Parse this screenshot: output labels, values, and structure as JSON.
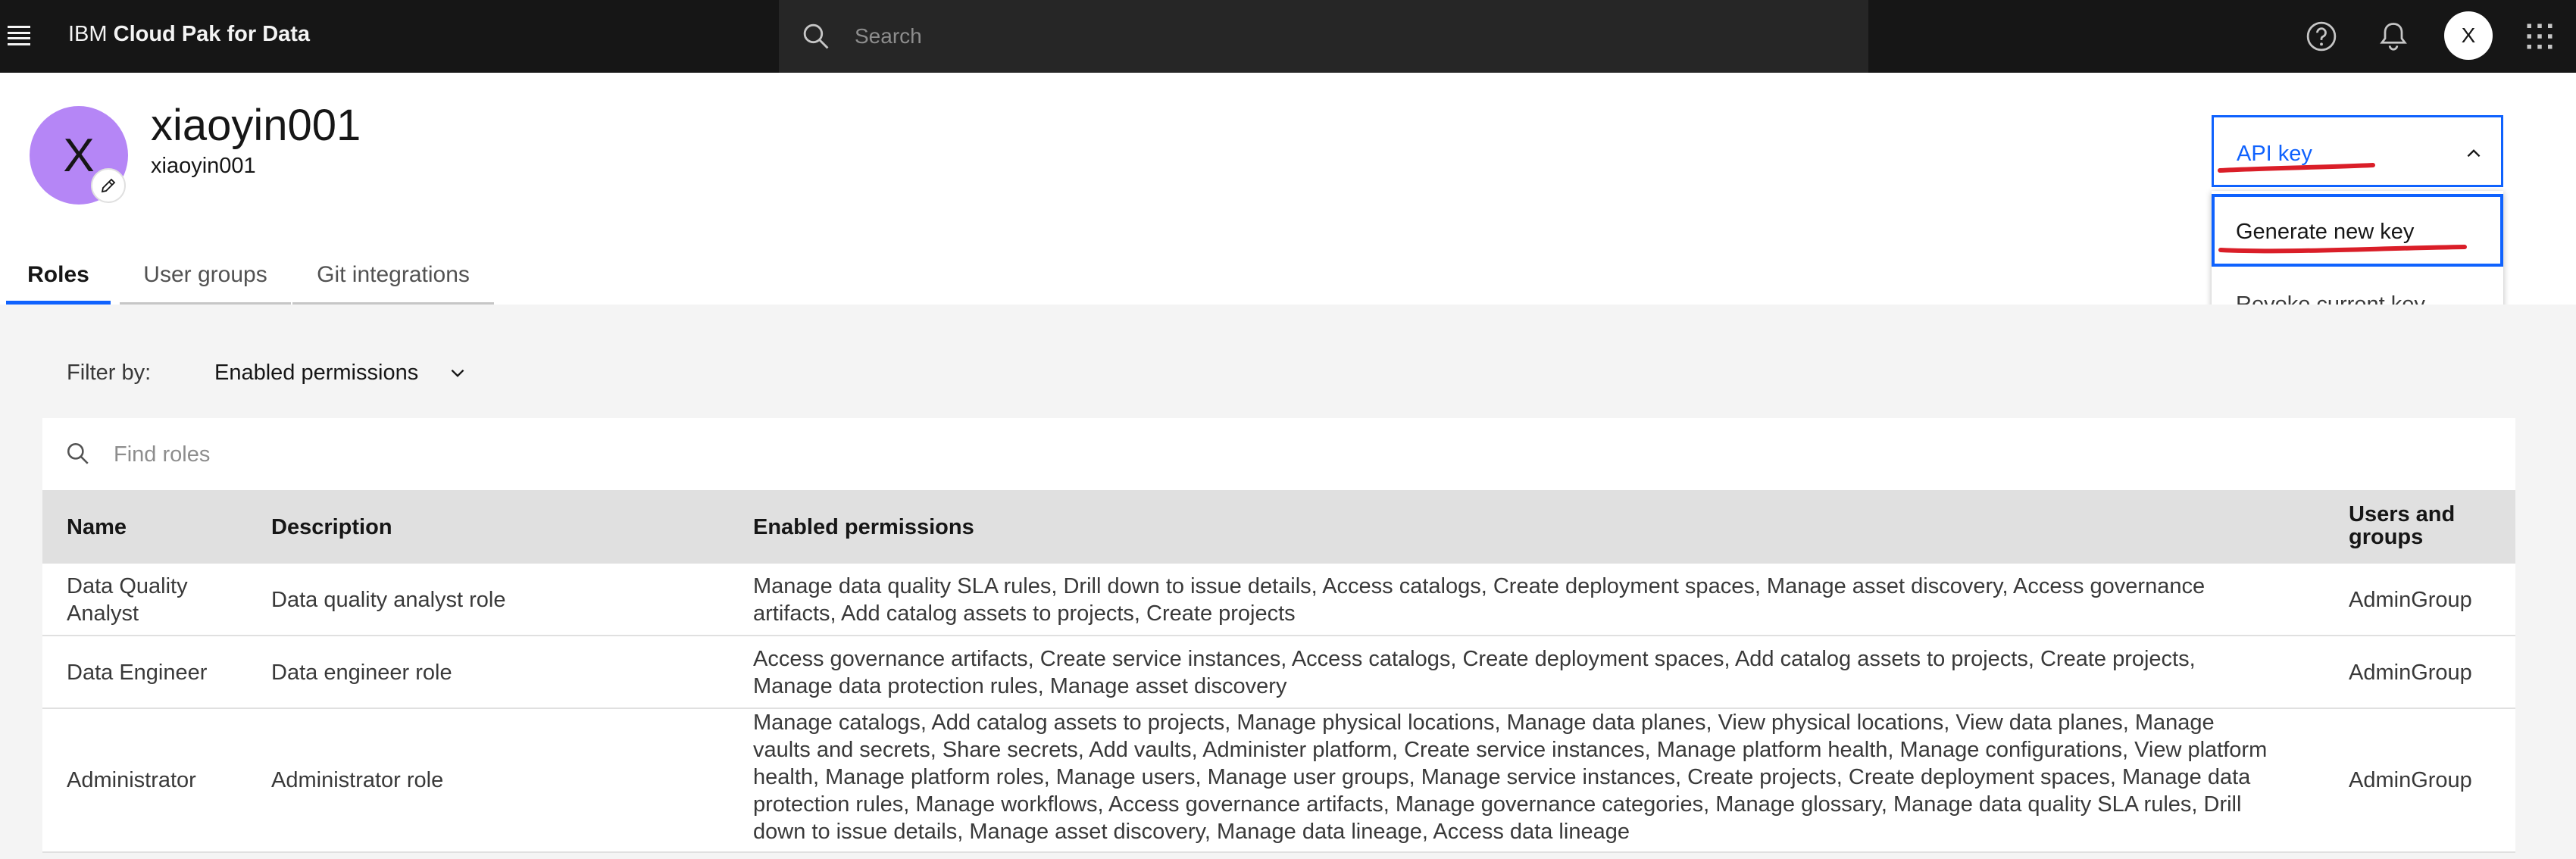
{
  "app": {
    "brand_prefix": "IBM",
    "brand_name": "Cloud Pak for Data",
    "search_placeholder": "Search",
    "user_initial": "X"
  },
  "profile": {
    "initial": "X",
    "display_name": "xiaoyin001",
    "username": "xiaoyin001"
  },
  "api_key": {
    "button_label": "API key",
    "menu_items": [
      "Generate new key",
      "Revoke current key"
    ]
  },
  "tabs": [
    {
      "label": "Roles",
      "active": true
    },
    {
      "label": "User groups",
      "active": false
    },
    {
      "label": "Git integrations",
      "active": false
    }
  ],
  "filter": {
    "label": "Filter by:",
    "selected": "Enabled permissions"
  },
  "find": {
    "placeholder": "Find roles"
  },
  "table": {
    "headers": [
      "Name",
      "Description",
      "Enabled permissions",
      "Users and groups"
    ],
    "rows": [
      {
        "name": "Data Quality Analyst",
        "description": "Data quality analyst role",
        "permissions": "Manage data quality SLA rules, Drill down to issue details, Access catalogs, Create deployment spaces, Manage asset discovery, Access governance artifacts, Add catalog assets to projects, Create projects",
        "groups": "AdminGroup"
      },
      {
        "name": "Data Engineer",
        "description": "Data engineer role",
        "permissions": "Access governance artifacts, Create service instances, Access catalogs, Create deployment spaces, Add catalog assets to projects, Create projects, Manage data protection rules, Manage asset discovery",
        "groups": "AdminGroup"
      },
      {
        "name": "Administrator",
        "description": "Administrator role",
        "permissions": "Manage catalogs, Add catalog assets to projects, Manage physical locations, Manage data planes, View physical locations, View data planes, Manage vaults and secrets, Share secrets, Add vaults, Administer platform, Create service instances, Manage platform health, Manage configurations, View platform health, Manage platform roles, Manage users, Manage user groups, Manage service instances, Create projects, Create deployment spaces, Manage data protection rules, Manage workflows, Access governance artifacts, Manage governance categories, Manage glossary, Manage data quality SLA rules, Drill down to issue details, Manage asset discovery, Manage data lineage, Access data lineage",
        "groups": "AdminGroup"
      }
    ]
  },
  "colors": {
    "topbar": "#161616",
    "accent": "#0f62fe",
    "avatar": "#b586f6",
    "annotation": "#da1e28"
  }
}
